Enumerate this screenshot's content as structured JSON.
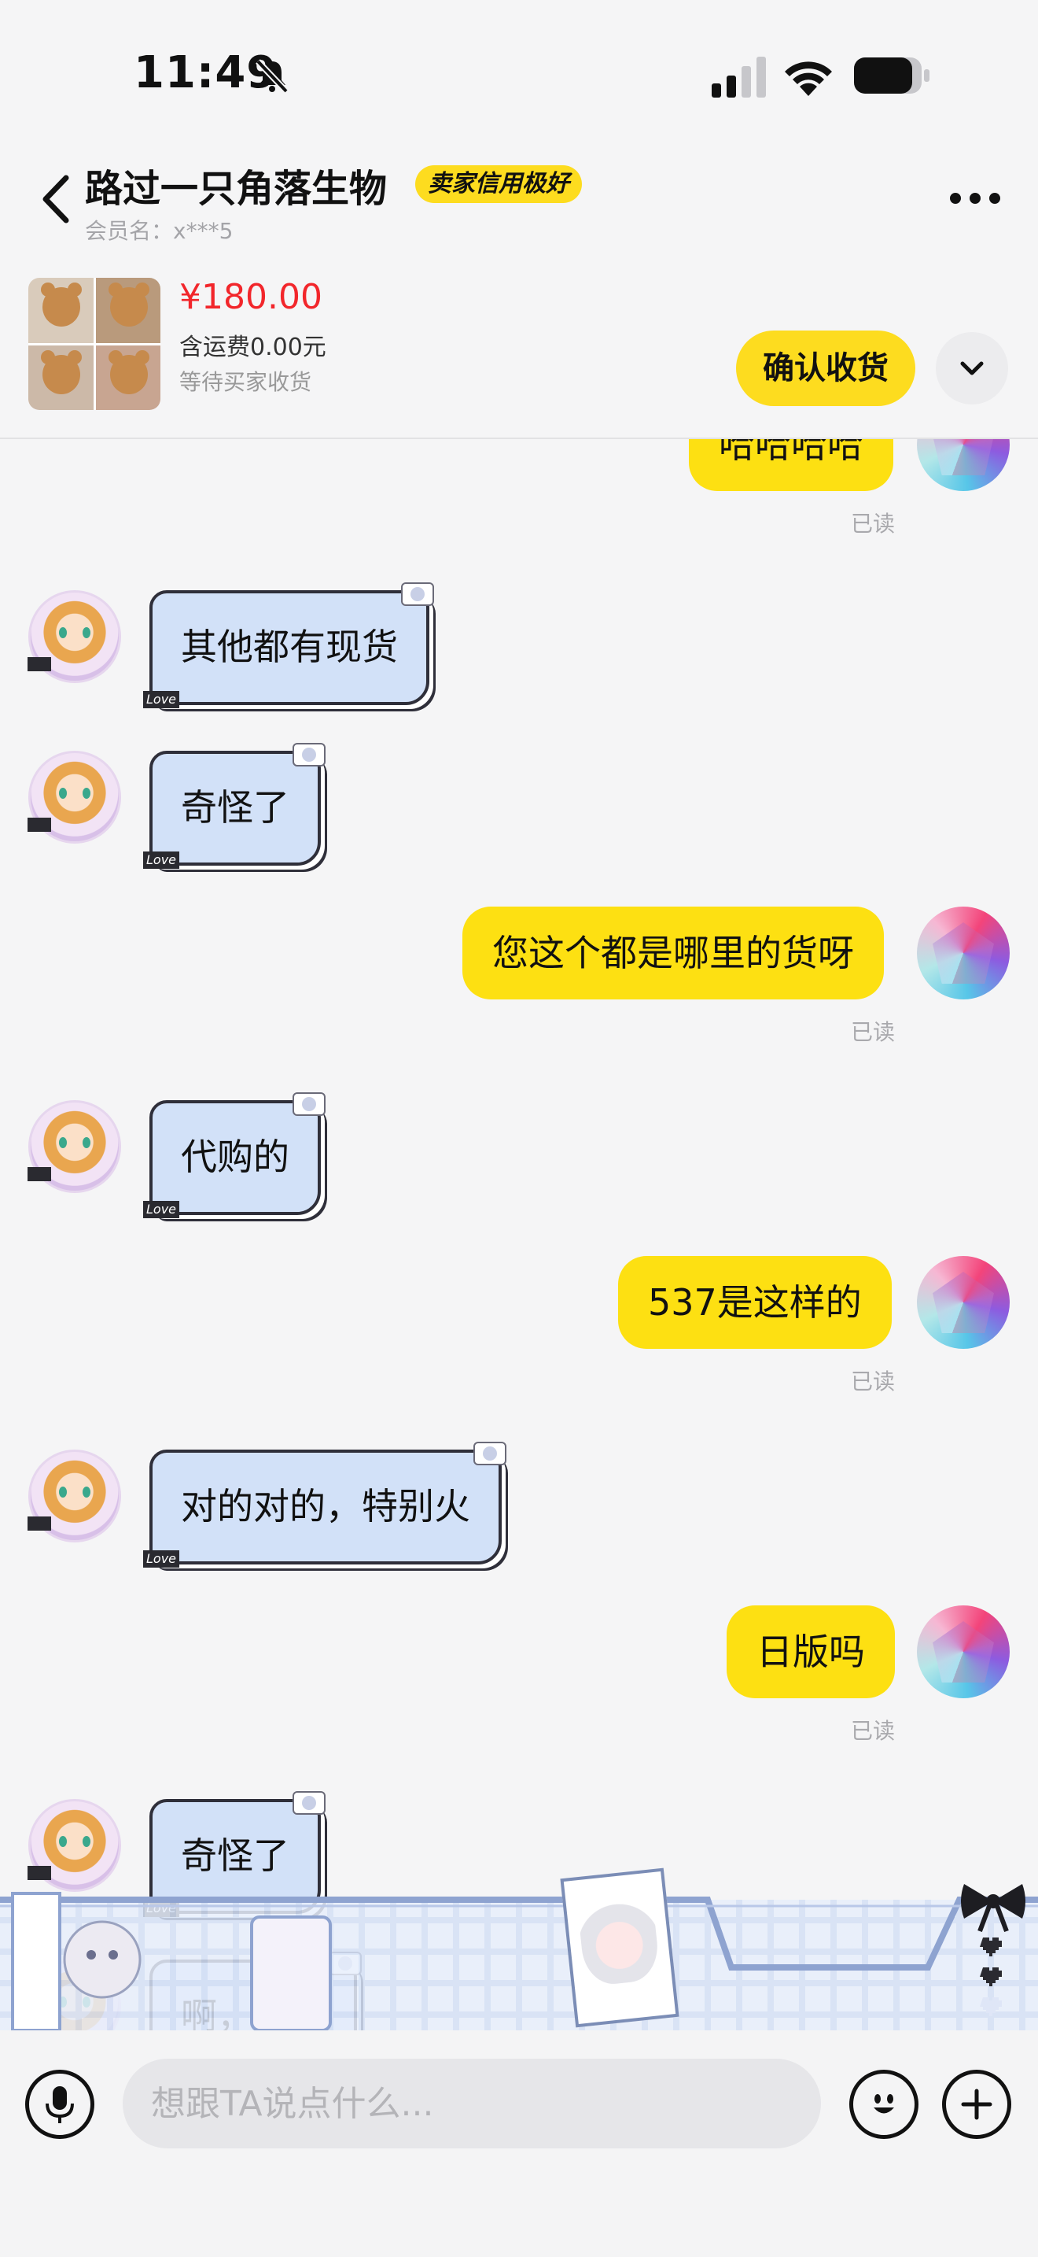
{
  "status_bar": {
    "time": "11:49",
    "icons": [
      "bell-muted-icon",
      "signal-icon",
      "wifi-icon",
      "battery-icon"
    ]
  },
  "header": {
    "title": "路过一只角落生物",
    "badge": "卖家信用极好",
    "member": "会员名：x***5",
    "icons": [
      "back-icon",
      "more-icon"
    ]
  },
  "order": {
    "price": "¥180.00",
    "shipping": "含运费0.00元",
    "status": "等待买家收货",
    "confirm_label": "确认收货",
    "expand_icon": "chevron-down-icon"
  },
  "messages": [
    {
      "from": "me",
      "text": "哈哈哈哈",
      "read": "已读"
    },
    {
      "from": "them",
      "text": "其他都有现货"
    },
    {
      "from": "them",
      "text": "奇怪了"
    },
    {
      "from": "me",
      "text": "您这个都是哪里的货呀",
      "read": "已读"
    },
    {
      "from": "them",
      "text": "代购的"
    },
    {
      "from": "me",
      "text": "537是这样的",
      "read": "已读"
    },
    {
      "from": "them",
      "text": "对的对的，特别火"
    },
    {
      "from": "me",
      "text": "日版吗",
      "read": "已读"
    },
    {
      "from": "them",
      "text": "奇怪了"
    },
    {
      "from": "them",
      "text": "啊，对的"
    }
  ],
  "bubble_tag": "Love",
  "input": {
    "placeholder": "想跟TA说点什么..."
  },
  "colors": {
    "accent_yellow": "#fde012",
    "price_red": "#f2262b",
    "incoming_bubble": "#d2e1f8",
    "read_gray": "#a9a9ad"
  }
}
